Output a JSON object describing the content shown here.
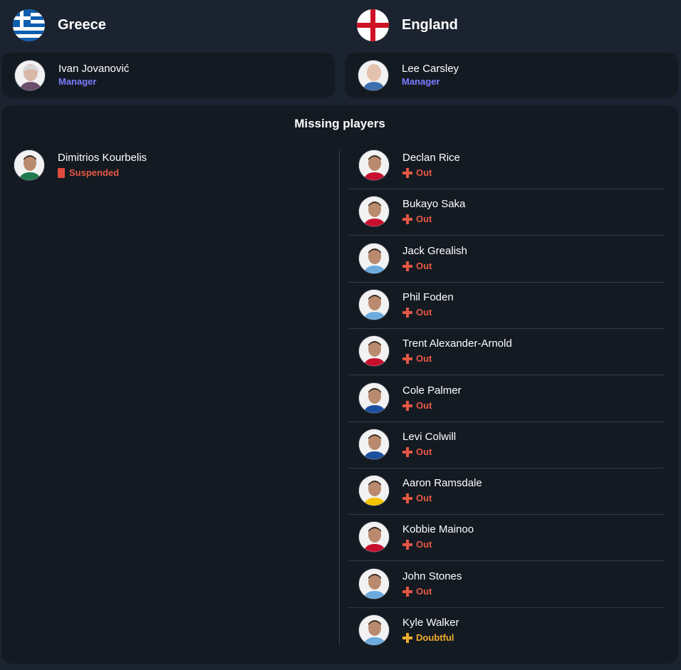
{
  "home": {
    "team": "Greece",
    "manager": {
      "name": "Ivan Jovanović",
      "role": "Manager"
    },
    "missing": [
      {
        "name": "Dimitrios Kourbelis",
        "status": "Suspended",
        "type": "suspended"
      }
    ]
  },
  "away": {
    "team": "England",
    "manager": {
      "name": "Lee Carsley",
      "role": "Manager"
    },
    "missing": [
      {
        "name": "Declan Rice",
        "status": "Out",
        "type": "out"
      },
      {
        "name": "Bukayo Saka",
        "status": "Out",
        "type": "out"
      },
      {
        "name": "Jack Grealish",
        "status": "Out",
        "type": "out"
      },
      {
        "name": "Phil Foden",
        "status": "Out",
        "type": "out"
      },
      {
        "name": "Trent Alexander-Arnold",
        "status": "Out",
        "type": "out"
      },
      {
        "name": "Cole Palmer",
        "status": "Out",
        "type": "out"
      },
      {
        "name": "Levi Colwill",
        "status": "Out",
        "type": "out"
      },
      {
        "name": "Aaron Ramsdale",
        "status": "Out",
        "type": "out"
      },
      {
        "name": "Kobbie Mainoo",
        "status": "Out",
        "type": "out"
      },
      {
        "name": "John Stones",
        "status": "Out",
        "type": "out"
      },
      {
        "name": "Kyle Walker",
        "status": "Doubtful",
        "type": "doubtful"
      }
    ]
  },
  "missing_title": "Missing players",
  "colors": {
    "background": "#1c2330",
    "card": "#141a22",
    "manager_role": "#7b7cff",
    "out": "#e65844",
    "doubtful": "#f0ad2e"
  },
  "icons": {
    "greece_flag": "greece-flag-icon",
    "england_flag": "england-flag-icon",
    "out": "injury-cross-icon",
    "doubtful": "doubtful-cross-icon",
    "suspended": "red-card-icon"
  }
}
